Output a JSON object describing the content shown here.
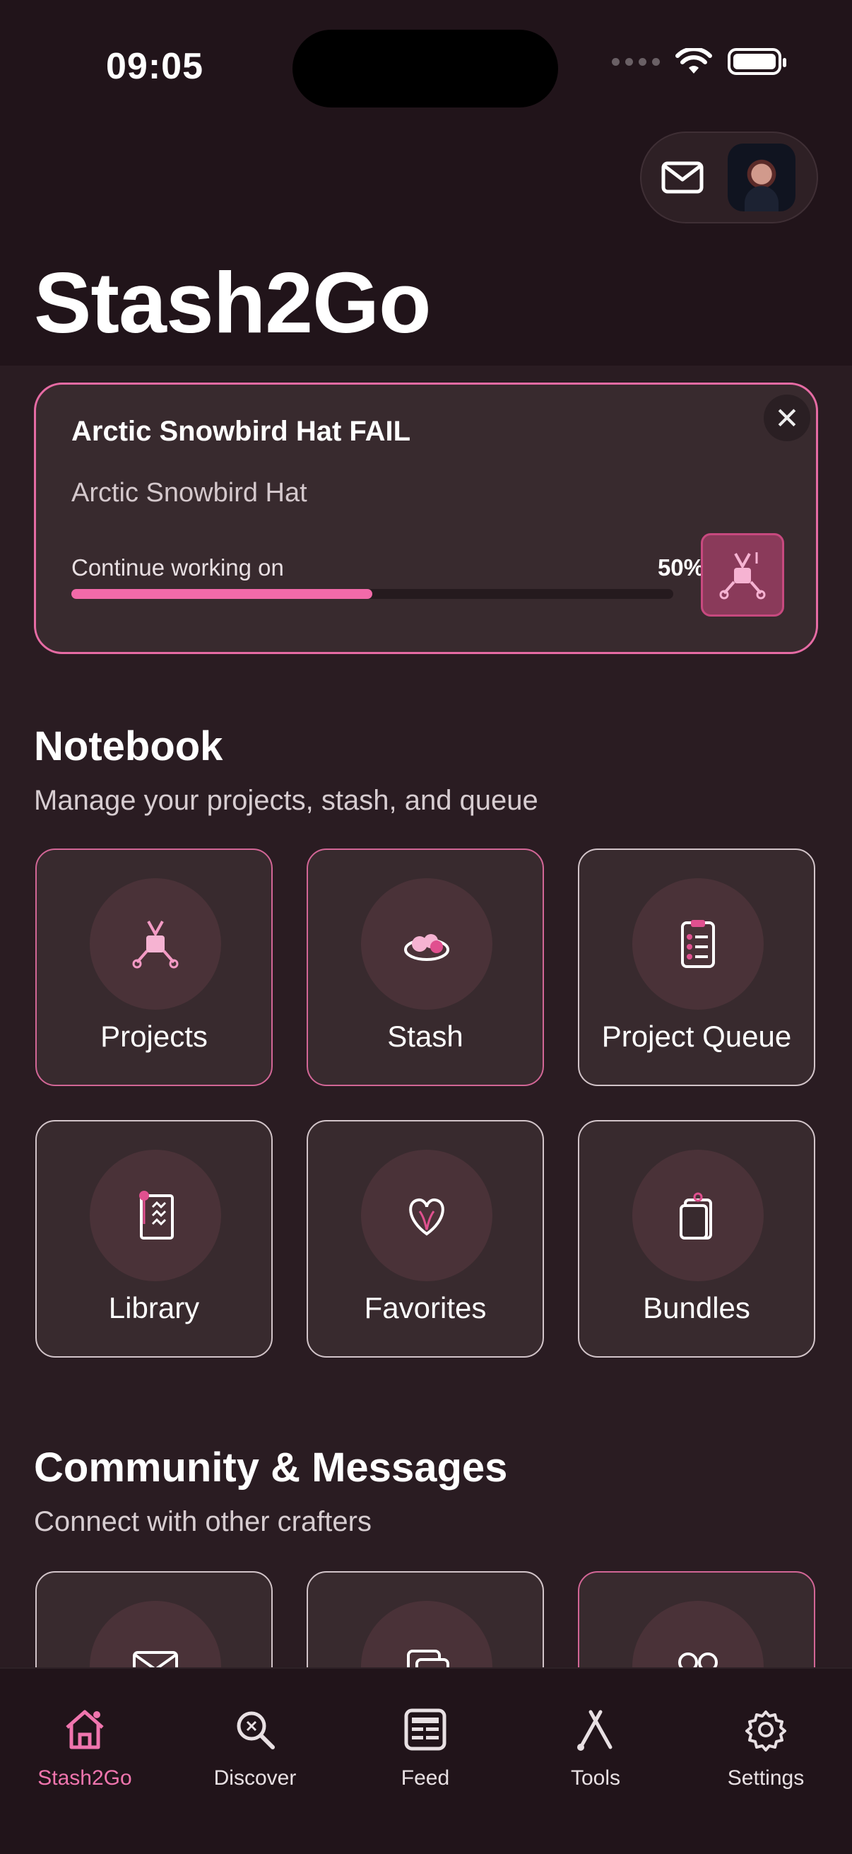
{
  "status_bar": {
    "time": "09:05"
  },
  "header": {
    "title": "Stash2Go"
  },
  "continue_card": {
    "title": "Arctic Snowbird Hat FAIL",
    "pattern": "Arctic Snowbird Hat",
    "label": "Continue working on",
    "progress": 50,
    "progress_text": "50%"
  },
  "notebook": {
    "title": "Notebook",
    "subtitle": "Manage your projects, stash, and queue",
    "tiles": [
      {
        "label": "Projects",
        "icon": "knitting-project-icon"
      },
      {
        "label": "Stash",
        "icon": "yarn-bowl-icon"
      },
      {
        "label": "Project Queue",
        "icon": "clipboard-list-icon"
      },
      {
        "label": "Library",
        "icon": "pattern-book-icon"
      },
      {
        "label": "Favorites",
        "icon": "heart-icon"
      },
      {
        "label": "Bundles",
        "icon": "bundle-bag-icon"
      }
    ]
  },
  "community": {
    "title": "Community & Messages",
    "subtitle": "Connect with other crafters"
  },
  "tabbar": {
    "tabs": [
      {
        "label": "Stash2Go",
        "icon": "home-icon",
        "active": true
      },
      {
        "label": "Discover",
        "icon": "discover-search-icon",
        "active": false
      },
      {
        "label": "Feed",
        "icon": "feed-icon",
        "active": false
      },
      {
        "label": "Tools",
        "icon": "tools-icon",
        "active": false
      },
      {
        "label": "Settings",
        "icon": "settings-gear-icon",
        "active": false
      }
    ]
  },
  "colors": {
    "accent": "#f26aa9",
    "background": "#2a1c22",
    "card": "#382a2e"
  }
}
